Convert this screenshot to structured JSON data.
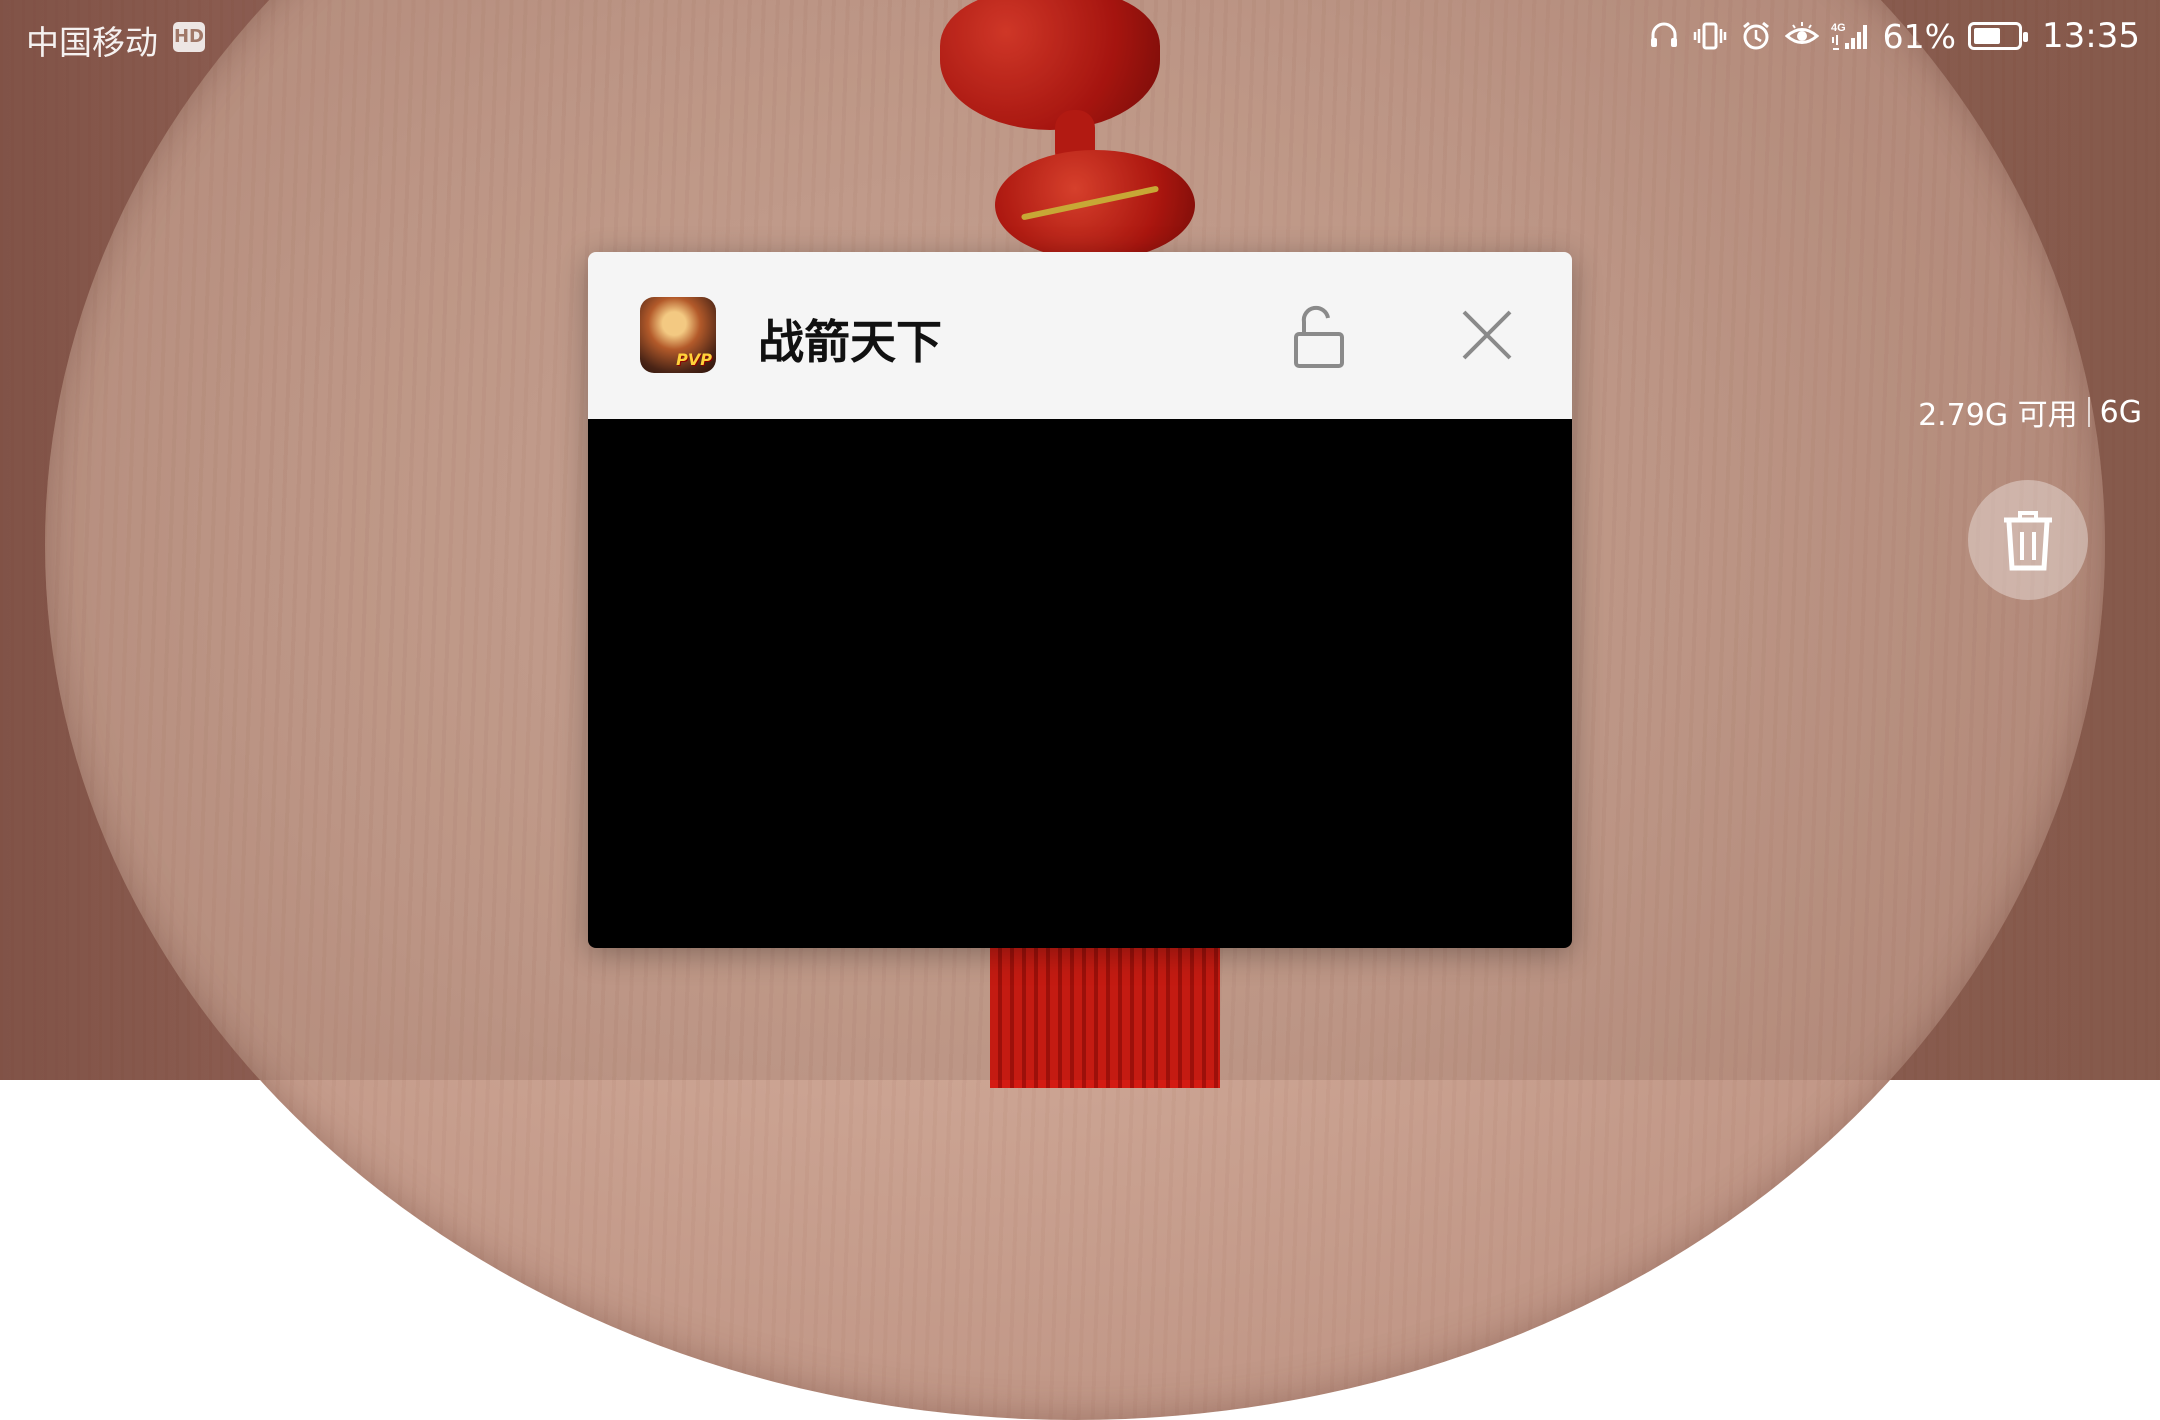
{
  "status_bar": {
    "carrier": "中国移动",
    "hd_badge": "HD",
    "network_type": "4G",
    "battery_percent_text": "61%",
    "battery_level": 0.61,
    "time": "13:35",
    "icons": [
      "headset-icon",
      "vibrate-icon",
      "alarm-icon",
      "eye-comfort-icon",
      "signal-4g-icon",
      "battery-icon"
    ]
  },
  "recent_task": {
    "app_name": "战箭天下",
    "app_icon_badge": "PVP",
    "lock_icon": "unlock-icon",
    "close_icon": "close-icon"
  },
  "memory": {
    "available": "2.79G 可用",
    "total": "6G"
  },
  "actions": {
    "clear_all_icon": "trash-icon"
  },
  "colors": {
    "card_header_bg": "#f5f5f5",
    "card_body_bg": "#000000",
    "text_light": "#ffffff"
  }
}
